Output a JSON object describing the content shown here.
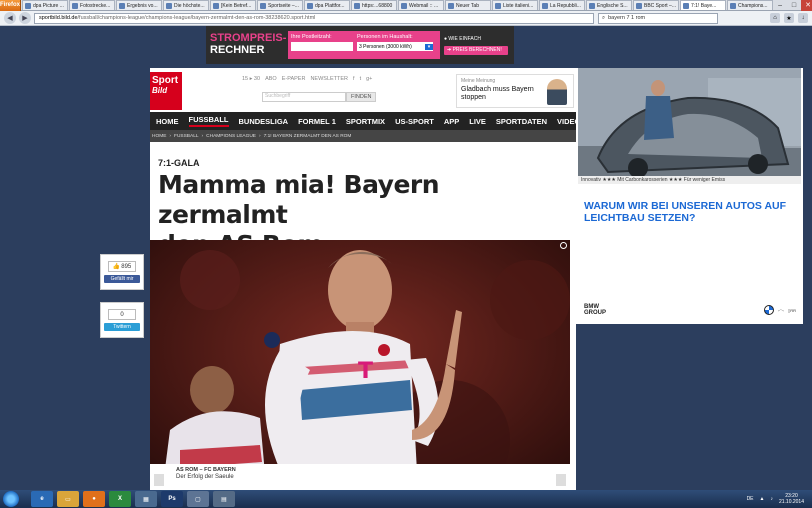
{
  "browser": {
    "menu_button": "Firefox",
    "tabs": [
      {
        "label": "dpa Picture ..."
      },
      {
        "label": "Fotostrecke..."
      },
      {
        "label": "Ergebnis vo..."
      },
      {
        "label": "Die höchste..."
      },
      {
        "label": "[Kein Betref..."
      },
      {
        "label": "Sportseite –..."
      },
      {
        "label": "dpa Plattfor..."
      },
      {
        "label": "https:...68800"
      },
      {
        "label": "Webmail :: ..."
      },
      {
        "label": "Neuer Tab"
      },
      {
        "label": "Liste italieni..."
      },
      {
        "label": "La Repubbli..."
      },
      {
        "label": "Englische S..."
      },
      {
        "label": "BBC Sport –..."
      },
      {
        "label": "7:1! Baye..."
      },
      {
        "label": "Champions..."
      }
    ],
    "url_host": "sportbild.bild.de",
    "url_path": "/fussball/champions-league/champions-league/bayern-zermalmt-den-as-rom-38238620.sport.html",
    "search_value": "bayern 7 1 rom"
  },
  "ad_top": {
    "logo_line1": "STROMPREIS-",
    "logo_line2": "RECHNER",
    "postcode_label": "Ihre Postleitzahl:",
    "persons_label": "Personen im Haushalt:",
    "persons_value": "3 Personen (3000 kWh)",
    "eco_label": "WIE EINFACH",
    "cta": "PREIS BERECHNEN!"
  },
  "header": {
    "logo_top": "Sport",
    "logo_bottom": "Bild",
    "service_links": [
      "15 ▸ 30",
      "ABO",
      "E-PAPER",
      "NEWSLETTER",
      "f",
      "t",
      "g+"
    ],
    "search_placeholder": "Suchbegriff",
    "search_button": "FINDEN",
    "opinion_kicker": "Meine Meinung",
    "opinion_title": "Gladbach muss Bayern stoppen"
  },
  "mainnav": [
    "HOME",
    "FUSSBALL",
    "BUNDESLIGA",
    "FORMEL 1",
    "SPORTMIX",
    "US-SPORT",
    "APP",
    "LIVE",
    "SPORTDATEN",
    "VIDEO"
  ],
  "breadcrumb": [
    "HOME",
    "FUSSBALL",
    "CHAMPIONS LEAGUE",
    "7:1! BAYERN ZERMALMT DEN AS ROM"
  ],
  "article": {
    "kicker": "7:1-GALA",
    "headline_line1": "Mamma mia! Bayern zermalmt",
    "headline_line2": "den AS Rom",
    "caption_title": "AS ROM – FC BAYERN",
    "caption_text": "Der Erfolg der Saeule"
  },
  "social": {
    "fb_count": "895",
    "fb_label": "Gefällt mir",
    "tw_count": "0",
    "tw_label": "Twittern"
  },
  "ad_right": {
    "strip_text": "Innovativ ★★★ Mit Carbonkarosserien ★★★ Für weniger Emiss",
    "question": "WARUM WIR BEI UNSEREN AUTOS AUF LEICHTBAU SETZEN?",
    "brand_line1": "BMW",
    "brand_line2": "GROUP"
  },
  "taskbar": {
    "lang": "DE",
    "time": "23:20",
    "date": "21.10.2014"
  },
  "colors": {
    "bild_red": "#d6001c",
    "nav_dark": "#232323",
    "page_bg": "#2c3e5e",
    "ad_pink": "#e8418a",
    "bmw_blue": "#1c69d4"
  }
}
